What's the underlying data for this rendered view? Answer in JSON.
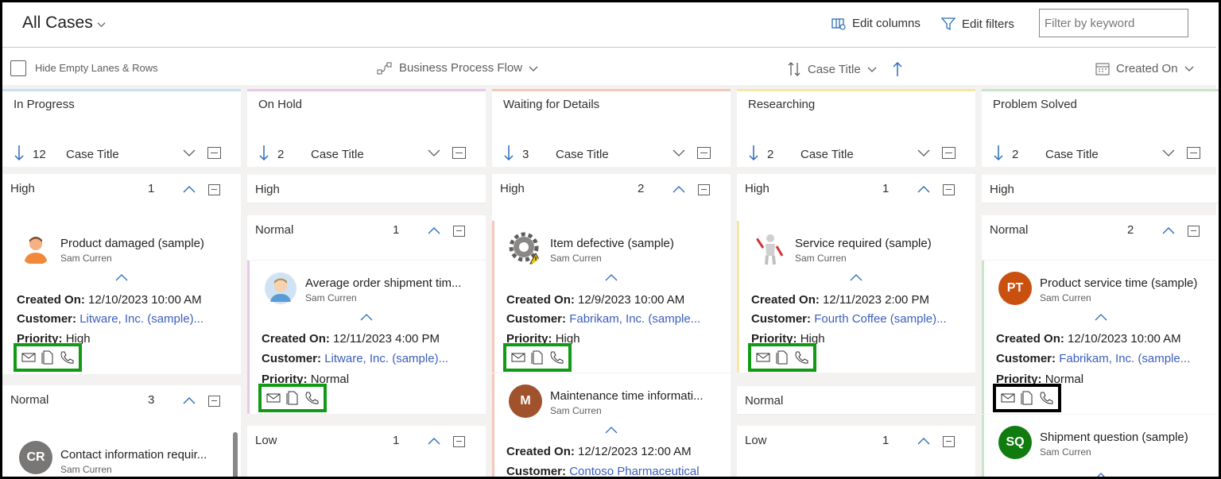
{
  "header": {
    "title": "All Cases",
    "edit_columns": "Edit columns",
    "edit_filters": "Edit filters",
    "filter_placeholder": "Filter by keyword"
  },
  "subbar": {
    "hide_empty": "Hide Empty Lanes & Rows",
    "bpf": "Business Process Flow",
    "sort_field": "Case Title",
    "created_on": "Created On"
  },
  "labels": {
    "created_on": "Created On:",
    "customer": "Customer:",
    "priority": "Priority:"
  },
  "lanes": [
    {
      "title": "In Progress",
      "count": "12",
      "field": "Case Title",
      "color": "#c7e0f4"
    },
    {
      "title": "On Hold",
      "count": "2",
      "field": "Case Title",
      "color": "#e8c8e8"
    },
    {
      "title": "Waiting for Details",
      "count": "3",
      "field": "Case Title",
      "color": "#f4c7b9"
    },
    {
      "title": "Researching",
      "count": "2",
      "field": "Case Title",
      "color": "#f6e7a6"
    },
    {
      "title": "Problem Solved",
      "count": "2",
      "field": "Case Title",
      "color": "#c9e6c9"
    }
  ],
  "groups": {
    "l0_high": {
      "name": "High",
      "count": "1"
    },
    "l0_normal": {
      "name": "Normal",
      "count": "3"
    },
    "l1_high": {
      "name": "High"
    },
    "l1_normal": {
      "name": "Normal",
      "count": "1"
    },
    "l1_low": {
      "name": "Low",
      "count": "1"
    },
    "l2_high": {
      "name": "High",
      "count": "2"
    },
    "l3_high": {
      "name": "High",
      "count": "1"
    },
    "l3_normal": {
      "name": "Normal"
    },
    "l3_low": {
      "name": "Low",
      "count": "1"
    },
    "l4_high": {
      "name": "High"
    },
    "l4_normal": {
      "name": "Normal",
      "count": "2"
    }
  },
  "cards": {
    "c1": {
      "title": "Product damaged (sample)",
      "owner": "Sam Curren",
      "created": "12/10/2023 10:00 AM",
      "customer": "Litware, Inc. (sample)...",
      "priority": "High"
    },
    "c2": {
      "title": "Contact information requir...",
      "owner": "Sam Curren",
      "initials": "CR"
    },
    "c3": {
      "title": "Average order shipment tim...",
      "owner": "Sam Curren",
      "created": "12/11/2023 4:00 PM",
      "customer": "Litware, Inc. (sample)...",
      "priority": "Normal"
    },
    "c4": {
      "title": "Item defective (sample)",
      "owner": "Sam Curren",
      "created": "12/9/2023 10:00 AM",
      "customer": "Fabrikam, Inc. (sample...",
      "priority": "High"
    },
    "c5": {
      "title": "Maintenance time informati...",
      "owner": "Sam Curren",
      "initials": "M",
      "created": "12/12/2023 12:00 AM",
      "customer": "Contoso Pharmaceutical"
    },
    "c6": {
      "title": "Service required (sample)",
      "owner": "Sam Curren",
      "created": "12/11/2023 2:00 PM",
      "customer": "Fourth Coffee (sample)...",
      "priority": "High"
    },
    "c7": {
      "title": "Product service time (sample)",
      "owner": "Sam Curren",
      "initials": "PT",
      "created": "12/10/2023 10:00 AM",
      "customer": "Fabrikam, Inc. (sample...",
      "priority": "Normal"
    },
    "c8": {
      "title": "Shipment question (sample)",
      "owner": "Sam Curren",
      "initials": "SQ"
    }
  }
}
